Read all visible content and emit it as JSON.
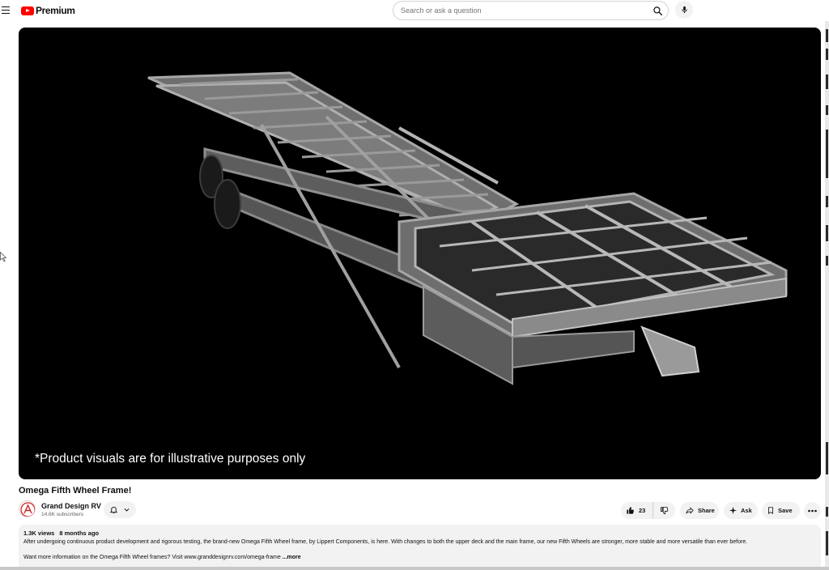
{
  "header": {
    "logo_text": "Premium",
    "search_placeholder": "Search or ask a question",
    "icons": [
      "menu-icon",
      "youtube-logo-icon",
      "search-icon",
      "microphone-icon"
    ]
  },
  "player": {
    "overlay_caption": "*Product visuals are for illustrative purposes only"
  },
  "video": {
    "title": "Omega Fifth Wheel Frame!"
  },
  "channel": {
    "name": "Grand Design RV",
    "subscribers": "14.6K subscribers"
  },
  "actions": {
    "like_count": "23",
    "share_label": "Share",
    "ask_label": "Ask",
    "save_label": "Save"
  },
  "description": {
    "views": "1.3K views",
    "age": "8 months ago",
    "line1": "After undergoing continuous product development and rigorous testing, the brand-new Omega Fifth Wheel frame, by Lippert Components, is here. With changes to both the upper deck and the main frame, our new Fifth Wheels are stronger, more stable and more versatile than ever before.",
    "line2": "Want more information on the Omega Fifth Wheel frames? Visit www.granddesignrv.com/omega-frame",
    "more_label": "...more"
  },
  "colors": {
    "brand_red": "#ff0000",
    "chip_bg": "#f2f2f2",
    "player_bg": "#000000",
    "frame_gray": "#8a8a8a"
  }
}
